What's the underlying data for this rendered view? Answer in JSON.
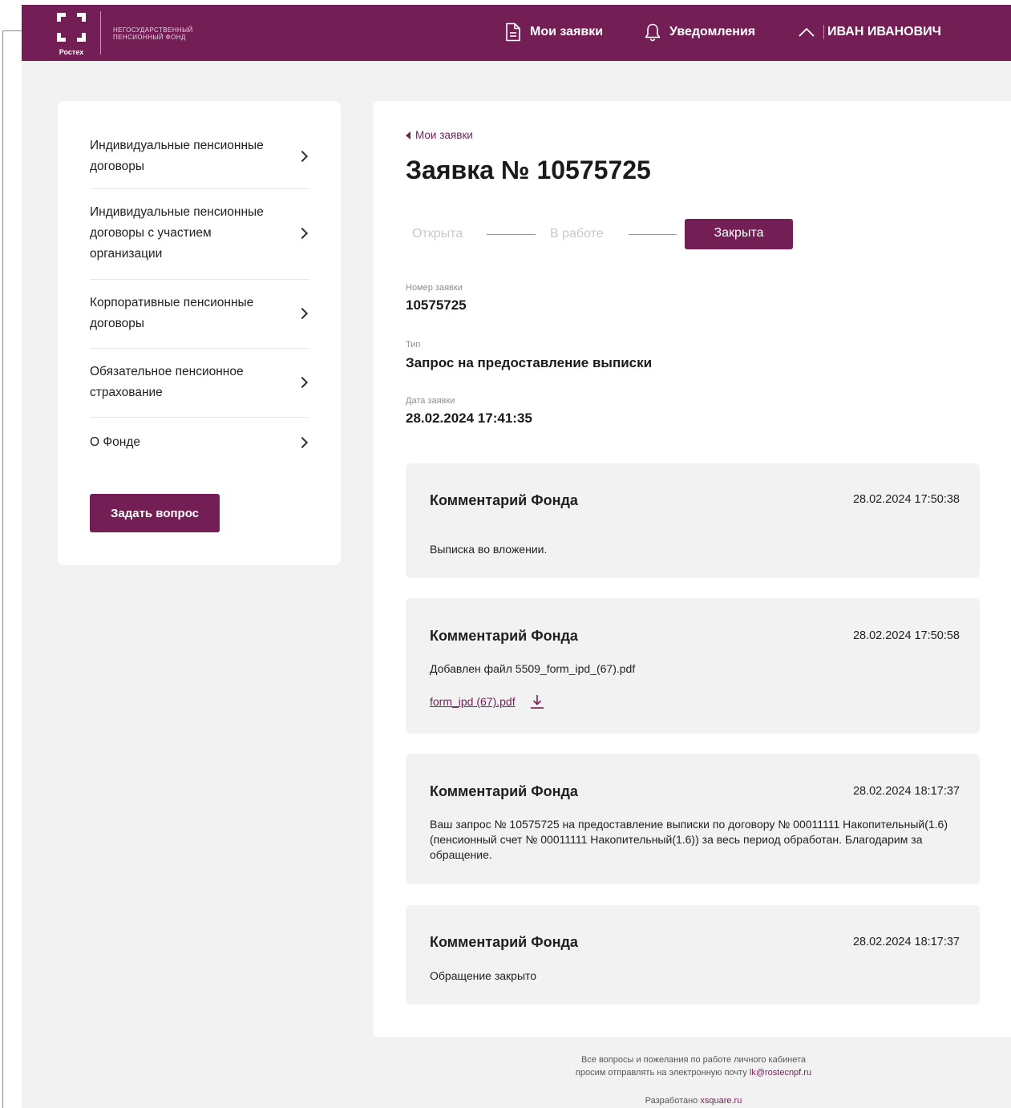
{
  "header": {
    "logo_word": "Ростех",
    "logo_text_line1": "НЕГОСУДАРСТВЕННЫЙ",
    "logo_text_line2": "ПЕНСИОННЫЙ ФОНД",
    "nav_requests": "Мои заявки",
    "nav_notifications": "Уведомления",
    "user_name": "ИВАН ИВАНОВИЧ",
    "accent_color": "#731f55"
  },
  "sidebar": {
    "items": [
      {
        "label": "Индивидуальные пенсионные договоры"
      },
      {
        "label": "Индивидуальные пенсионные договоры с участием организации"
      },
      {
        "label": "Корпоративные пенсионные договоры"
      },
      {
        "label": "Обязательное пенсионное страхование"
      },
      {
        "label": "О Фонде"
      }
    ],
    "ask_button": "Задать вопрос"
  },
  "main": {
    "back_link": "Мои заявки",
    "title": "Заявка № 10575725",
    "statuses": {
      "open": "Открыта",
      "in_work": "В работе",
      "closed": "Закрыта",
      "current": "closed"
    },
    "fields": {
      "number_label": "Номер заявки",
      "number_value": "10575725",
      "type_label": "Тип",
      "type_value": "Запрос на предоставление выписки",
      "date_label": "Дата заявки",
      "date_value": "28.02.2024 17:41:35"
    },
    "comments": [
      {
        "title": "Комментарий Фонда",
        "date": "28.02.2024 17:50:38",
        "text": "Выписка во вложении."
      },
      {
        "title": "Комментарий Фонда",
        "date": "28.02.2024 17:50:58",
        "text": "Добавлен файл 5509_form_ipd_(67).pdf",
        "file": "form_ipd (67).pdf"
      },
      {
        "title": "Комментарий Фонда",
        "date": "28.02.2024 18:17:37",
        "text": "Ваш запрос № 10575725 на предоставление выписки по договору № 00011111 Накопительный(1.6) (пенсионный счет № 00011111 Накопительный(1.6)) за весь период обработан. Благодарим за обращение."
      },
      {
        "title": "Комментарий Фонда",
        "date": "28.02.2024 18:17:37",
        "text": "Обращение закрыто"
      }
    ]
  },
  "footer": {
    "line1": "Все вопросы и пожелания по работе личного кабинета",
    "line2_prefix": "просим отправлять на электронную почту ",
    "email": "lk@rostecnpf.ru",
    "dev_prefix": "Разработано ",
    "dev_link": "xsquare.ru"
  }
}
